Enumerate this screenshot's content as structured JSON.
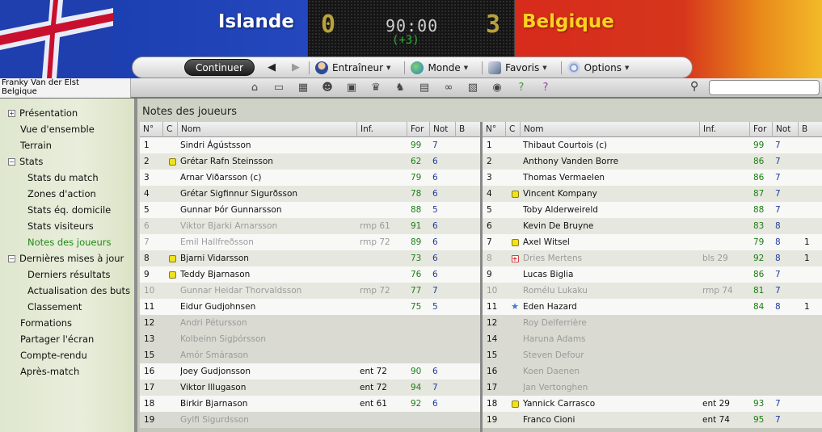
{
  "match": {
    "home_team": "Islande",
    "away_team": "Belgique",
    "home_score": "0",
    "away_score": "3",
    "clock": "90:00",
    "extra": "(+3)"
  },
  "toolbar": {
    "continue_label": "Continuer",
    "menus": [
      {
        "label": "Entraîneur",
        "icon": "manager-icon"
      },
      {
        "label": "Monde",
        "icon": "globe-icon"
      },
      {
        "label": "Favoris",
        "icon": "favorites-icon"
      },
      {
        "label": "Options",
        "icon": "options-icon"
      }
    ]
  },
  "manager": {
    "name": "Franky Van der Elst",
    "country": "Belgique"
  },
  "search": {
    "placeholder": ""
  },
  "quick_icons": [
    "home-icon",
    "ticket-icon",
    "calendar-icon",
    "team-icon",
    "tactics-icon",
    "trophy-icon",
    "scout-icon",
    "clipboard-icon",
    "binoculars-icon",
    "document-icon",
    "globe-icon",
    "help-icon",
    "question-icon"
  ],
  "sidebar": {
    "items": [
      {
        "label": "Présentation",
        "level": 0,
        "expander": "+"
      },
      {
        "label": "Vue d'ensemble",
        "level": 0
      },
      {
        "label": "Terrain",
        "level": 0
      },
      {
        "label": "Stats",
        "level": 0,
        "expander": "−"
      },
      {
        "label": "Stats du match",
        "level": 1
      },
      {
        "label": "Zones d'action",
        "level": 1
      },
      {
        "label": "Stats éq. domicile",
        "level": 1
      },
      {
        "label": "Stats visiteurs",
        "level": 1
      },
      {
        "label": "Notes des joueurs",
        "level": 1,
        "active": true
      },
      {
        "label": "Dernières mises à jour",
        "level": 0,
        "expander": "−"
      },
      {
        "label": "Derniers résultats",
        "level": 1
      },
      {
        "label": "Actualisation des buts",
        "level": 1
      },
      {
        "label": "Classement",
        "level": 1
      },
      {
        "label": "Formations",
        "level": 0
      },
      {
        "label": "Partager l'écran",
        "level": 0
      },
      {
        "label": "Compte-rendu",
        "level": 0
      },
      {
        "label": "Après-match",
        "level": 0
      }
    ]
  },
  "page_title": "Notes des joueurs",
  "columns": {
    "num": "N°",
    "card": "C",
    "name": "Nom",
    "inf": "Inf.",
    "for": "For",
    "not": "Not",
    "b": "B"
  },
  "home_players": [
    {
      "num": "1",
      "card": "",
      "name": "Sindri Ágústsson",
      "inf": "",
      "for": "99",
      "not": "7",
      "b": "",
      "dim": false
    },
    {
      "num": "2",
      "card": "yellow",
      "name": "Grétar Rafn Steinsson",
      "inf": "",
      "for": "62",
      "not": "6",
      "b": "",
      "dim": false
    },
    {
      "num": "3",
      "card": "",
      "name": "Arnar Viðarsson (c)",
      "inf": "",
      "for": "79",
      "not": "6",
      "b": "",
      "dim": false
    },
    {
      "num": "4",
      "card": "",
      "name": "Grétar Sigfinnur Sigurðsson",
      "inf": "",
      "for": "78",
      "not": "6",
      "b": "",
      "dim": false
    },
    {
      "num": "5",
      "card": "",
      "name": "Gunnar Þór Gunnarsson",
      "inf": "",
      "for": "88",
      "not": "5",
      "b": "",
      "dim": false
    },
    {
      "num": "6",
      "card": "",
      "name": "Viktor Bjarki Arnarsson",
      "inf": "rmp 61",
      "for": "91",
      "not": "6",
      "b": "",
      "dim": true
    },
    {
      "num": "7",
      "card": "",
      "name": "Emil Hallfreðsson",
      "inf": "rmp 72",
      "for": "89",
      "not": "6",
      "b": "",
      "dim": true
    },
    {
      "num": "8",
      "card": "yellow",
      "name": "Bjarni Vidarsson",
      "inf": "",
      "for": "73",
      "not": "6",
      "b": "",
      "dim": false
    },
    {
      "num": "9",
      "card": "yellow",
      "name": "Teddy Bjarnason",
      "inf": "",
      "for": "76",
      "not": "6",
      "b": "",
      "dim": false
    },
    {
      "num": "10",
      "card": "",
      "name": "Gunnar Heidar Thorvaldsson",
      "inf": "rmp 72",
      "for": "77",
      "not": "7",
      "b": "",
      "dim": true
    },
    {
      "num": "11",
      "card": "",
      "name": "Eidur Gudjohnsen",
      "inf": "",
      "for": "75",
      "not": "5",
      "b": "",
      "dim": false
    },
    {
      "num": "12",
      "card": "",
      "name": "Andri Pétursson",
      "inf": "",
      "for": "",
      "not": "",
      "b": "",
      "dim": false,
      "empty": true
    },
    {
      "num": "13",
      "card": "",
      "name": "Kolbeinn Sigþórsson",
      "inf": "",
      "for": "",
      "not": "",
      "b": "",
      "dim": false,
      "empty": true
    },
    {
      "num": "15",
      "card": "",
      "name": "Amór Smárason",
      "inf": "",
      "for": "",
      "not": "",
      "b": "",
      "dim": false,
      "empty": true
    },
    {
      "num": "16",
      "card": "",
      "name": "Joey Gudjonsson",
      "inf": "ent 72",
      "for": "90",
      "not": "6",
      "b": "",
      "dim": false
    },
    {
      "num": "17",
      "card": "",
      "name": "Viktor Illugason",
      "inf": "ent 72",
      "for": "94",
      "not": "7",
      "b": "",
      "dim": false
    },
    {
      "num": "18",
      "card": "",
      "name": "Birkir Bjarnason",
      "inf": "ent 61",
      "for": "92",
      "not": "6",
      "b": "",
      "dim": false
    },
    {
      "num": "19",
      "card": "",
      "name": "Gylfi Sigurdsson",
      "inf": "",
      "for": "",
      "not": "",
      "b": "",
      "dim": false,
      "empty": true
    }
  ],
  "away_players": [
    {
      "num": "1",
      "card": "",
      "name": "Thibaut Courtois (c)",
      "inf": "",
      "for": "99",
      "not": "7",
      "b": "",
      "dim": false
    },
    {
      "num": "2",
      "card": "",
      "name": "Anthony Vanden Borre",
      "inf": "",
      "for": "86",
      "not": "7",
      "b": "",
      "dim": false
    },
    {
      "num": "3",
      "card": "",
      "name": "Thomas Vermaelen",
      "inf": "",
      "for": "86",
      "not": "7",
      "b": "",
      "dim": false
    },
    {
      "num": "4",
      "card": "yellow",
      "name": "Vincent Kompany",
      "inf": "",
      "for": "87",
      "not": "7",
      "b": "",
      "dim": false
    },
    {
      "num": "5",
      "card": "",
      "name": "Toby Alderweireld",
      "inf": "",
      "for": "88",
      "not": "7",
      "b": "",
      "dim": false
    },
    {
      "num": "6",
      "card": "",
      "name": "Kevin De Bruyne",
      "inf": "",
      "for": "83",
      "not": "8",
      "b": "",
      "dim": false
    },
    {
      "num": "7",
      "card": "yellow",
      "name": "Axel Witsel",
      "inf": "",
      "for": "79",
      "not": "8",
      "b": "1",
      "dim": false
    },
    {
      "num": "8",
      "card": "injury",
      "name": "Dries Mertens",
      "inf": "bls 29",
      "for": "92",
      "not": "8",
      "b": "1",
      "dim": true
    },
    {
      "num": "9",
      "card": "",
      "name": "Lucas Biglia",
      "inf": "",
      "for": "86",
      "not": "7",
      "b": "",
      "dim": false
    },
    {
      "num": "10",
      "card": "",
      "name": "Romélu Lukaku",
      "inf": "rmp 74",
      "for": "81",
      "not": "7",
      "b": "",
      "dim": true
    },
    {
      "num": "11",
      "card": "star",
      "name": "Eden Hazard",
      "inf": "",
      "for": "84",
      "not": "8",
      "b": "1",
      "dim": false
    },
    {
      "num": "12",
      "card": "",
      "name": "Roy Delferrière",
      "inf": "",
      "for": "",
      "not": "",
      "b": "",
      "dim": false,
      "empty": true
    },
    {
      "num": "14",
      "card": "",
      "name": "Haruna Adams",
      "inf": "",
      "for": "",
      "not": "",
      "b": "",
      "dim": false,
      "empty": true
    },
    {
      "num": "15",
      "card": "",
      "name": "Steven Defour",
      "inf": "",
      "for": "",
      "not": "",
      "b": "",
      "dim": false,
      "empty": true
    },
    {
      "num": "16",
      "card": "",
      "name": "Koen Daenen",
      "inf": "",
      "for": "",
      "not": "",
      "b": "",
      "dim": false,
      "empty": true
    },
    {
      "num": "17",
      "card": "",
      "name": "Jan Vertonghen",
      "inf": "",
      "for": "",
      "not": "",
      "b": "",
      "dim": false,
      "empty": true
    },
    {
      "num": "18",
      "card": "yellow",
      "name": "Yannick Carrasco",
      "inf": "ent 29",
      "for": "93",
      "not": "7",
      "b": "",
      "dim": false
    },
    {
      "num": "19",
      "card": "",
      "name": "Franco Cioni",
      "inf": "ent 74",
      "for": "95",
      "not": "7",
      "b": "",
      "dim": false
    }
  ],
  "colors": {
    "for_value": "#1d7d15",
    "not_value": "#1f3c9e",
    "active_nav": "#1d8a12",
    "yellow_card": "#f0e21b"
  }
}
